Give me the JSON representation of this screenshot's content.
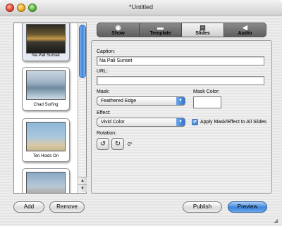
{
  "window": {
    "title": "*Untitled"
  },
  "tabs": [
    {
      "label": "Show",
      "icon": "eye-icon",
      "glyph": "◉"
    },
    {
      "label": "Template",
      "icon": "template-icon",
      "glyph": "▬"
    },
    {
      "label": "Slides",
      "icon": "slides-icon",
      "glyph": "▤"
    },
    {
      "label": "Audio",
      "icon": "speaker-icon",
      "glyph": "◀"
    }
  ],
  "active_tab": "Slides",
  "photos": [
    {
      "caption": "Na Pali Sunset",
      "selected": true
    },
    {
      "caption": "Chad Surfing",
      "selected": false
    },
    {
      "caption": "Teri Holds On",
      "selected": false
    },
    {
      "caption": "",
      "selected": false
    }
  ],
  "form": {
    "caption_label": "Caption:",
    "caption_value": "Na Pali Sunset",
    "url_label": "URL:",
    "url_value": "",
    "mask_label": "Mask:",
    "mask_value": "Feathered Edge",
    "mask_color_label": "Mask Color:",
    "effect_label": "Effect:",
    "effect_value": "Vivid Color",
    "apply_all_label": "Apply Mask/Effect to All Slides",
    "apply_all_checked": true,
    "rotation_label": "Rotation:",
    "rotation_value": "0°"
  },
  "buttons": {
    "add": "Add",
    "remove": "Remove",
    "publish": "Publish",
    "preview": "Preview"
  },
  "colors": {
    "accent": "#3d86dc",
    "tab_bar": "#6e6e6e"
  }
}
